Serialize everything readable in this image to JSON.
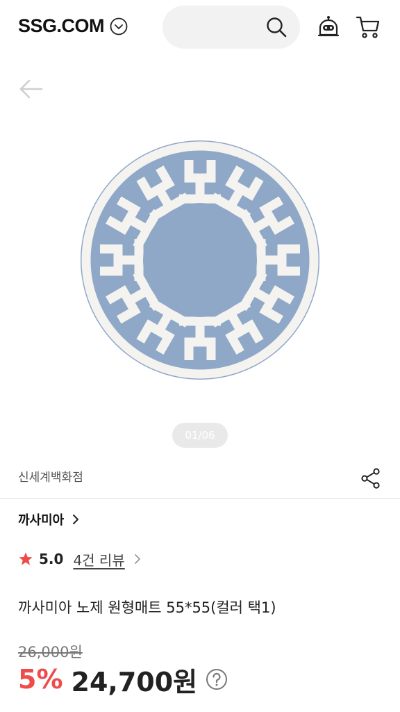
{
  "header": {
    "logo": "SSG.COM",
    "icons": {
      "logo_menu": "chevron-down-circle-icon",
      "search": "search-icon",
      "bot": "chatbot-icon",
      "cart": "cart-icon"
    }
  },
  "nav": {
    "back_icon": "back-arrow-icon"
  },
  "gallery": {
    "counter": "01/06",
    "colors": {
      "rug_blue": "#8fa8c8",
      "rug_white": "#f4f3ef"
    }
  },
  "store": {
    "name": "신세계백화점",
    "share_icon": "share-icon"
  },
  "brand": {
    "name": "까사미아"
  },
  "rating": {
    "score": "5.0",
    "reviews_label": "4건 리뷰",
    "star_color": "#ee4b4b"
  },
  "product": {
    "title": "까사미아 노제 원형매트 55*55(컬러 택1)"
  },
  "price": {
    "original": "26,000원",
    "discount": "5%",
    "sale": "24,700원",
    "discount_color": "#ee4b4b"
  }
}
